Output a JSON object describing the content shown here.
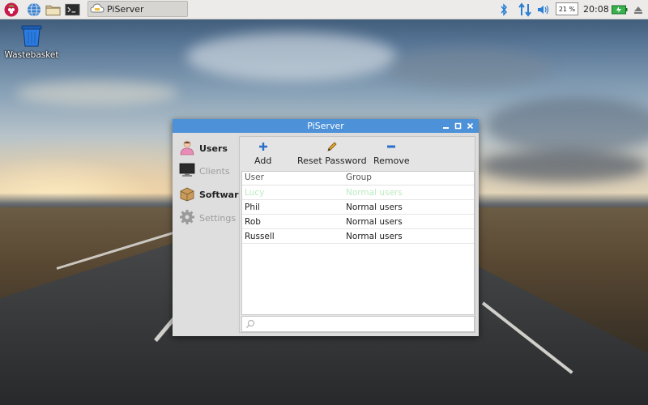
{
  "taskbar": {
    "icons": [
      "raspberry-menu-icon",
      "web-browser-icon",
      "file-manager-icon",
      "terminal-icon"
    ],
    "task": {
      "label": "PiServer",
      "icon": "piserver-cloud-icon"
    },
    "tray": {
      "bluetooth_icon": "bluetooth-icon",
      "network_icon": "network-arrows-icon",
      "volume_icon": "volume-icon",
      "cpu_usage": "21 %",
      "clock": "20:08",
      "battery_icon": "battery-charging-icon",
      "eject_icon": "eject-icon"
    }
  },
  "desktop": {
    "wastebasket_label": "Wastebasket"
  },
  "window": {
    "title": "PiServer",
    "controls": [
      "minimize",
      "maximize",
      "close"
    ],
    "sidebar": {
      "items": [
        {
          "label": "Users",
          "icon": "user-icon",
          "state": "active"
        },
        {
          "label": "Clients",
          "icon": "monitor-icon",
          "state": "disabled"
        },
        {
          "label": "Software",
          "icon": "package-icon",
          "state": "normal"
        },
        {
          "label": "Settings",
          "icon": "gear-icon",
          "state": "disabled"
        }
      ]
    },
    "toolbar": {
      "add_label": "Add",
      "reset_label": "Reset Password",
      "remove_label": "Remove"
    },
    "table": {
      "columns": [
        "User",
        "Group"
      ],
      "rows": [
        {
          "user": "Lucy",
          "group": "Normal users",
          "style": "faded"
        },
        {
          "user": "Phil",
          "group": "Normal users"
        },
        {
          "user": "Rob",
          "group": "Normal users"
        },
        {
          "user": "Russell",
          "group": "Normal users"
        }
      ]
    },
    "search": {
      "value": "",
      "placeholder": ""
    }
  },
  "colors": {
    "titlebar": "#4d92d9",
    "accent": "#2a7fd4",
    "faded_row_text": "#bdeac1",
    "battery": "#37b24d"
  }
}
